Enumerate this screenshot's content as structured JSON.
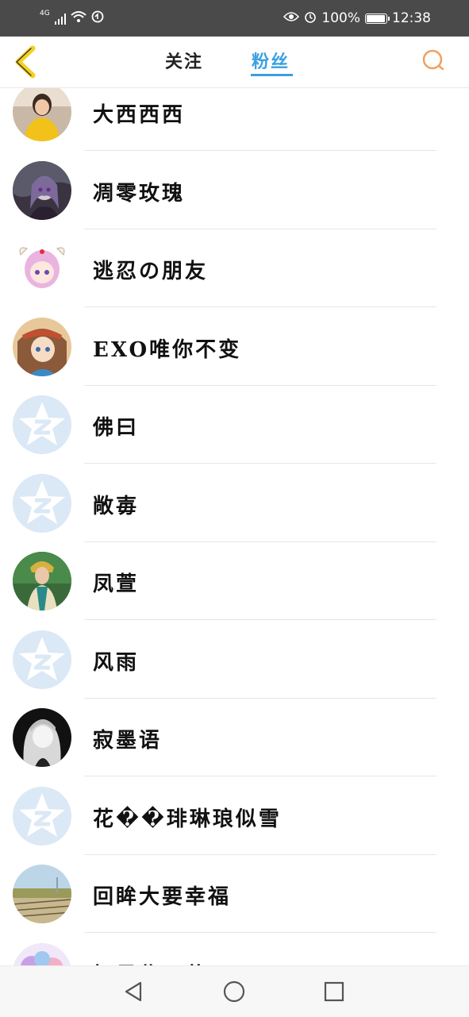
{
  "status_bar": {
    "network": "4G",
    "battery": "100%",
    "time": "12:38",
    "battery_level": 1.0
  },
  "header": {
    "tabs": [
      {
        "label": "关注"
      },
      {
        "label": "粉丝"
      }
    ],
    "active_tab": "粉丝"
  },
  "fans": [
    {
      "name": "大西西西",
      "avatar": "photo-yellow"
    },
    {
      "name": "凋零玫瑰",
      "avatar": "anime-dark"
    },
    {
      "name": "逃忍の朋友",
      "avatar": "anime-pink"
    },
    {
      "name": "EXO唯你不变",
      "avatar": "anime-brown"
    },
    {
      "name": "佛曰",
      "avatar": "default-star-icon"
    },
    {
      "name": "敞毐",
      "avatar": "default-star-icon"
    },
    {
      "name": "凤萱",
      "avatar": "photo-costume"
    },
    {
      "name": "风雨",
      "avatar": "default-star-icon"
    },
    {
      "name": "寂墨语",
      "avatar": "bw-anime"
    },
    {
      "name": "花��琲琳琅似雪",
      "avatar": "default-star-icon"
    },
    {
      "name": "回眸大要幸福",
      "avatar": "photo-field"
    },
    {
      "name": "忆星紫瓦花",
      "avatar": "anime-colorful"
    }
  ],
  "colors": {
    "accent": "#3aa0e0",
    "back_arrow": "#f5d020",
    "search_icon": "#f0a060",
    "status_bar_bg": "#4a4a4a",
    "default_avatar_bg": "#dbe8f5"
  }
}
